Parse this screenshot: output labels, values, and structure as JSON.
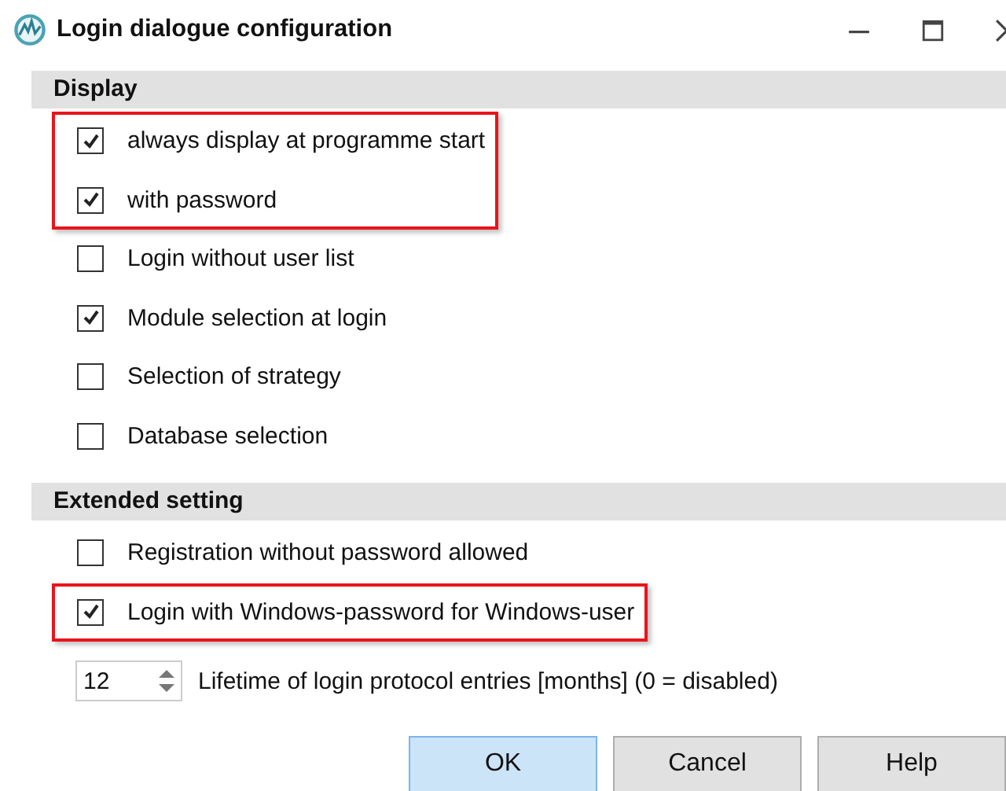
{
  "window": {
    "title": "Login dialogue configuration"
  },
  "sections": [
    {
      "title": "Display",
      "groups": [
        {
          "highlighted": true,
          "items": [
            {
              "label": "always display at programme start",
              "checked": true
            },
            {
              "label": "with password",
              "checked": true
            }
          ]
        },
        {
          "highlighted": false,
          "items": [
            {
              "label": "Login without user list",
              "checked": false
            },
            {
              "label": "Module selection at login",
              "checked": true
            },
            {
              "label": "Selection of strategy",
              "checked": false
            },
            {
              "label": "Database selection",
              "checked": false
            }
          ]
        }
      ]
    },
    {
      "title": "Extended setting",
      "groups": [
        {
          "highlighted": false,
          "items": [
            {
              "label": "Registration without password allowed",
              "checked": false
            }
          ]
        },
        {
          "highlighted": true,
          "items": [
            {
              "label": "Login with Windows-password for Windows-user",
              "checked": true
            }
          ]
        }
      ]
    }
  ],
  "spinner": {
    "value": "12",
    "label": "Lifetime of login protocol entries [months] (0 = disabled)"
  },
  "buttons": [
    {
      "label": "OK",
      "default": true
    },
    {
      "label": "Cancel",
      "default": false
    },
    {
      "label": "Help",
      "default": false
    }
  ]
}
